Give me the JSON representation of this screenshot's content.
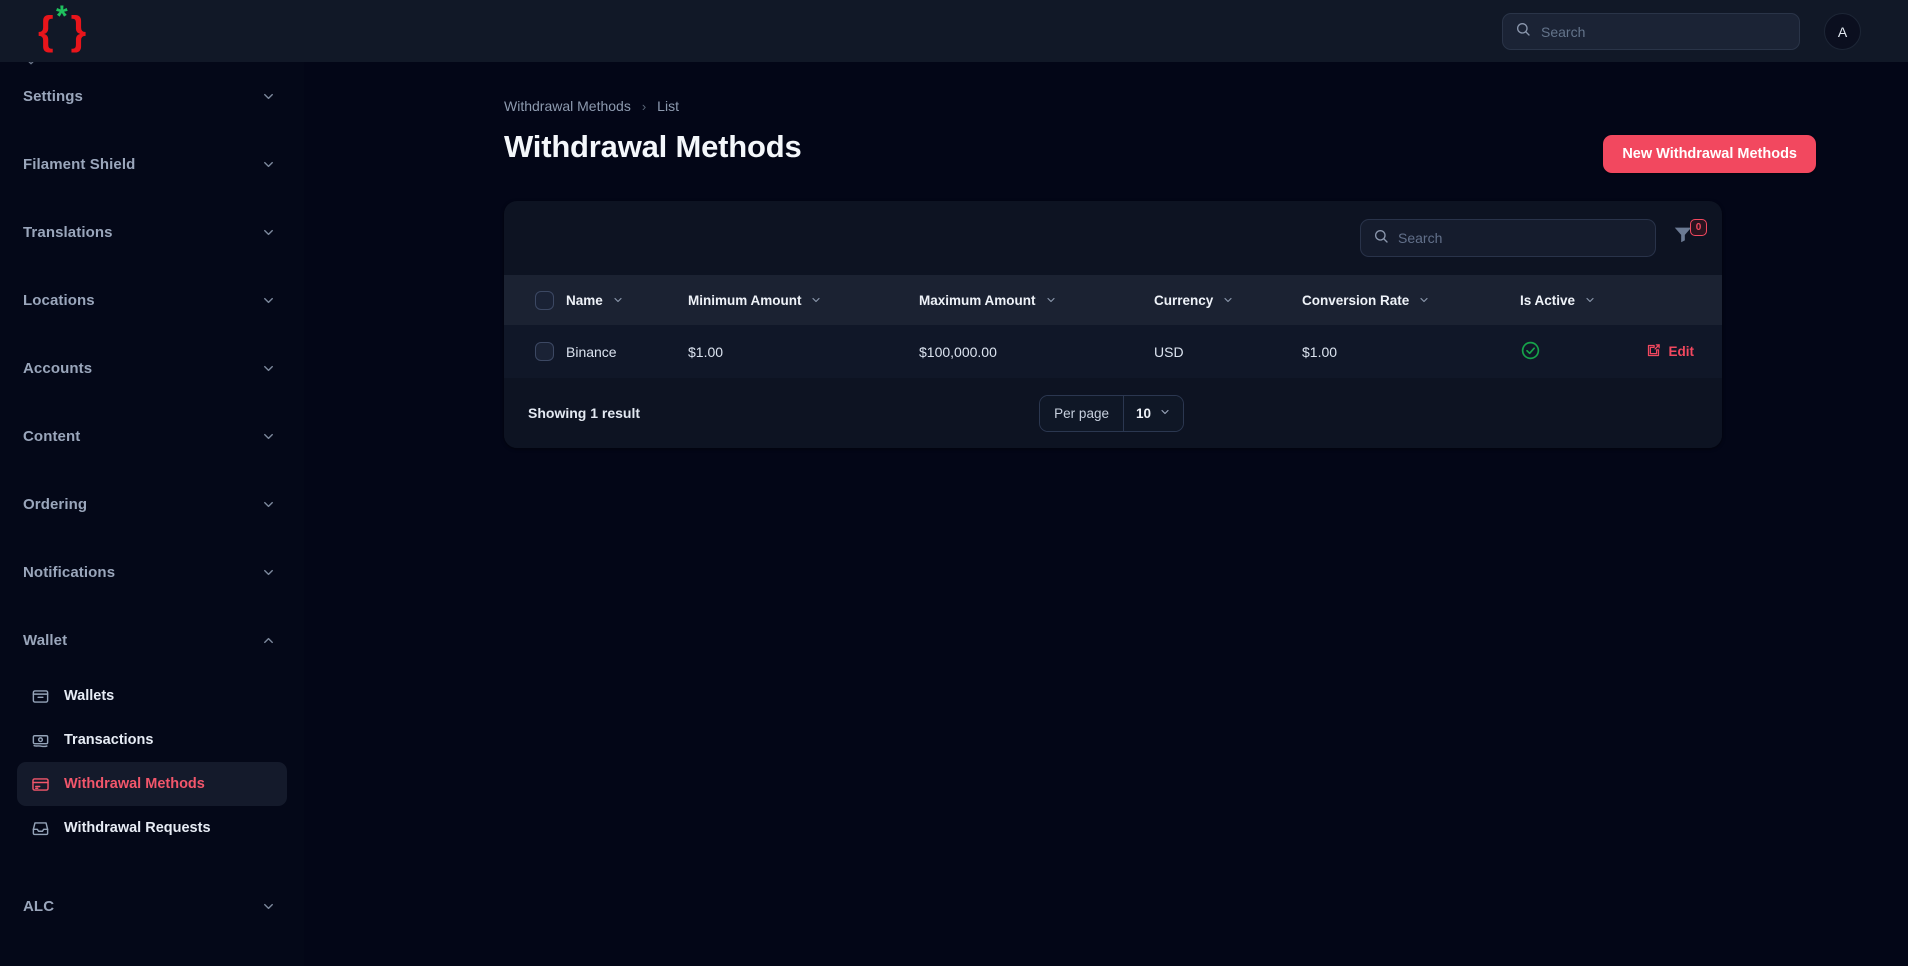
{
  "topbar": {
    "logo_brace": "{ }",
    "logo_star": "*",
    "search_placeholder": "Search",
    "search_value": "",
    "avatar_initial": "A"
  },
  "sidebar": {
    "groups": [
      {
        "label": "Settings",
        "icon": "chevron-down-icon",
        "expanded": false
      },
      {
        "label": "Filament Shield",
        "icon": "chevron-down-icon",
        "expanded": false
      },
      {
        "label": "Translations",
        "icon": "chevron-down-icon",
        "expanded": false
      },
      {
        "label": "Locations",
        "icon": "chevron-down-icon",
        "expanded": false
      },
      {
        "label": "Accounts",
        "icon": "chevron-down-icon",
        "expanded": false
      },
      {
        "label": "Content",
        "icon": "chevron-down-icon",
        "expanded": false
      },
      {
        "label": "Ordering",
        "icon": "chevron-down-icon",
        "expanded": false
      },
      {
        "label": "Notifications",
        "icon": "chevron-down-icon",
        "expanded": false
      },
      {
        "label": "Wallet",
        "icon": "chevron-up-icon",
        "expanded": true
      },
      {
        "label": "ALC",
        "icon": "chevron-down-icon",
        "expanded": false
      }
    ],
    "wallet_items": [
      {
        "label": "Wallets",
        "icon": "wallet-icon",
        "active": false
      },
      {
        "label": "Transactions",
        "icon": "banknote-icon",
        "active": false
      },
      {
        "label": "Withdrawal Methods",
        "icon": "credit-card-icon",
        "active": true
      },
      {
        "label": "Withdrawal Requests",
        "icon": "inbox-icon",
        "active": false
      }
    ]
  },
  "main": {
    "breadcrumb": [
      "Withdrawal Methods",
      "List"
    ],
    "breadcrumb_separator": "›",
    "page_title": "Withdrawal Methods",
    "new_button_label": "New Withdrawal Methods"
  },
  "table_panel": {
    "search_placeholder": "Search",
    "search_value": "",
    "filter_icon": "funnel-icon",
    "filter_badge_count": "0",
    "columns": [
      {
        "label": "Name",
        "sort_icon": "chevron-down-icon"
      },
      {
        "label": "Minimum Amount",
        "sort_icon": "chevron-down-icon"
      },
      {
        "label": "Maximum Amount",
        "sort_icon": "chevron-down-icon"
      },
      {
        "label": "Currency",
        "sort_icon": "chevron-down-icon"
      },
      {
        "label": "Conversion Rate",
        "sort_icon": "chevron-down-icon"
      },
      {
        "label": "Is Active",
        "sort_icon": "chevron-down-icon"
      }
    ],
    "rows": [
      {
        "name": "Binance",
        "minimum_amount": "$1.00",
        "maximum_amount": "$100,000.00",
        "currency": "USD",
        "conversion_rate": "$1.00",
        "is_active": true,
        "is_active_icon": "check-circle-icon",
        "edit_label": "Edit",
        "edit_icon": "pencil-square-icon"
      }
    ],
    "footer": {
      "showing_text": "Showing 1 result",
      "per_page_label": "Per page",
      "per_page_value": "10",
      "per_page_icon": "chevron-down-icon"
    }
  },
  "colors": {
    "accent": "#f2485f",
    "page_background": "#030617",
    "panel_background": "#0d1322",
    "table_header": "#1b2232",
    "row_background": "#101728",
    "success": "#16a34a",
    "logo_brace": "#e8151b",
    "logo_star": "#1fc15e"
  }
}
